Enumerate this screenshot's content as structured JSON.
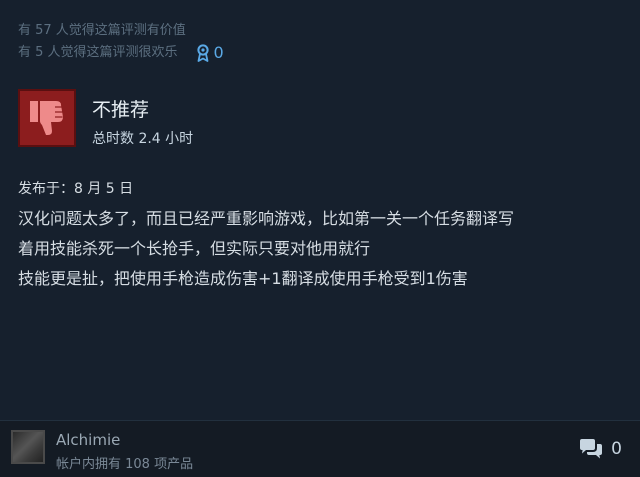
{
  "helpful": {
    "useful_line": "有 57 人觉得这篇评测有价值",
    "funny_line": "有 5 人觉得这篇评测很欢乐",
    "award_count": "0"
  },
  "review": {
    "verdict": "不推荐",
    "hours": "总时数 2.4 小时",
    "posted": "发布于：8 月 5 日",
    "body_lines": [
      "汉化问题太多了，而且已经严重影响游戏，比如第一关一个任务翻译写",
      "着用技能杀死一个长抢手，但实际只要对他用就行",
      "技能更是扯，把使用手枪造成伤害+1翻译成使用手枪受到1伤害"
    ]
  },
  "author": {
    "name": "Alchimie",
    "products": "帐户内拥有 108 项产品"
  },
  "comments": {
    "count": "0"
  },
  "colors": {
    "thumb_background": "#8c1d1e",
    "award_accent": "#5aa9e6",
    "card_background": "#16202d"
  },
  "icons": {
    "verdict": "thumbs-down-icon",
    "award": "award-ribbon-icon",
    "comments": "speech-bubbles-icon"
  }
}
